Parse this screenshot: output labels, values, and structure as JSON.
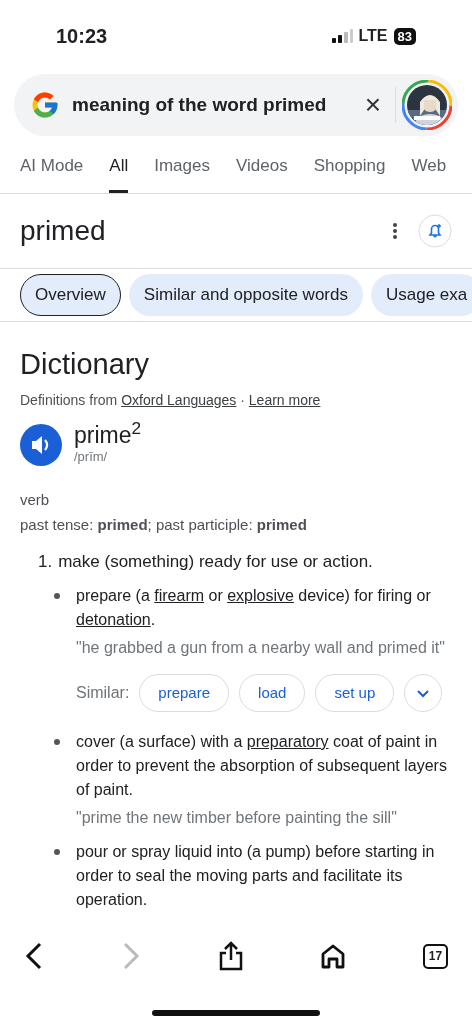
{
  "status_bar": {
    "time": "10:23",
    "network": "LTE",
    "battery": "83"
  },
  "search": {
    "value": "meaning of the word primed",
    "clear": "×"
  },
  "tabs": [
    {
      "label": "AI Mode",
      "selected": false
    },
    {
      "label": "All",
      "selected": true
    },
    {
      "label": "Images",
      "selected": false
    },
    {
      "label": "Videos",
      "selected": false
    },
    {
      "label": "Shopping",
      "selected": false
    },
    {
      "label": "Web",
      "selected": false
    }
  ],
  "query_title": "primed",
  "chips": [
    {
      "label": "Overview",
      "selected": true
    },
    {
      "label": "Similar and opposite words",
      "selected": false
    },
    {
      "label": "Usage exa",
      "selected": false
    }
  ],
  "dictionary": {
    "heading": "Dictionary",
    "source": [
      {
        "kind": "text",
        "text": "Definitions from "
      },
      {
        "kind": "link",
        "text": "Oxford Languages"
      },
      {
        "kind": "text",
        "text": " · "
      },
      {
        "kind": "link",
        "text": "Learn more"
      }
    ],
    "word": "prime$^{2}$",
    "pronunciation": "/prīm/",
    "part_of_speech": "verb",
    "forms": "past tense: **primed**; past participle: **primed**",
    "definitions": [
      {
        "number": "1.",
        "text": "make (something) ready for use or action.",
        "senses": [
          {
            "parts": [
              {
                "kind": "text",
                "text": "prepare (a "
              },
              {
                "kind": "link",
                "text": "firearm"
              },
              {
                "kind": "text",
                "text": " or "
              },
              {
                "kind": "link",
                "text": "explosive"
              },
              {
                "kind": "text",
                "text": " device) for firing or "
              },
              {
                "kind": "link",
                "text": "detonation"
              },
              {
                "kind": "text",
                "text": "."
              }
            ],
            "example": "\"he grabbed a gun from a nearby wall and primed it\"",
            "similar_label": "Similar:",
            "similar": [
              "prepare",
              "load",
              "set up"
            ]
          },
          {
            "parts": [
              {
                "kind": "text",
                "text": "cover (a surface) with a "
              },
              {
                "kind": "link",
                "text": "preparatory"
              },
              {
                "kind": "text",
                "text": " coat of paint in order to prevent the absorption of subsequent layers of paint."
              }
            ],
            "example": "\"prime the new timber before painting the sill\""
          },
          {
            "parts": [
              {
                "kind": "text",
                "text": "pour or spray liquid into (a pump) before starting in order to seal the moving parts and facilitate its operation."
              }
            ]
          }
        ]
      }
    ]
  },
  "toolbar": {
    "tab_count": "17"
  }
}
